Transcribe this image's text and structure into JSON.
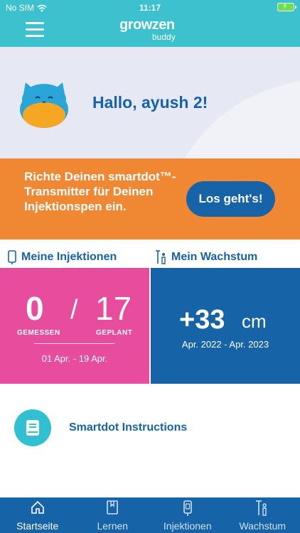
{
  "status": {
    "carrier": "No SIM",
    "time": "11:17"
  },
  "header": {
    "logo_main": "growzen",
    "logo_sub": "buddy"
  },
  "greeting": {
    "text": "Hallo, ayush 2!"
  },
  "promo": {
    "text": "Richte Deinen smartdot™-Transmitter für Deinen Injektionspen ein.",
    "button_label": "Los geht's!"
  },
  "tabs": {
    "injections": "Meine Injektionen",
    "growth": "Mein Wachstum"
  },
  "injections": {
    "measured_value": "0",
    "slash": "/",
    "planned_value": "17",
    "measured_label": "GEMESSEN",
    "planned_label": "GEPLANT",
    "range": "01 Apr. - 19 Apr."
  },
  "growth": {
    "value": "+33",
    "unit": "cm",
    "range": "Apr. 2022 - Apr. 2023"
  },
  "smartdot": {
    "label": "Smartdot Instructions"
  },
  "nav": {
    "items": [
      {
        "label": "Startseite"
      },
      {
        "label": "Lernen"
      },
      {
        "label": "Injektionen"
      },
      {
        "label": "Wachstum"
      }
    ]
  },
  "colors": {
    "teal": "#3cc1cf",
    "blue": "#1763a8",
    "orange": "#f08833",
    "pink": "#e84c9c"
  }
}
